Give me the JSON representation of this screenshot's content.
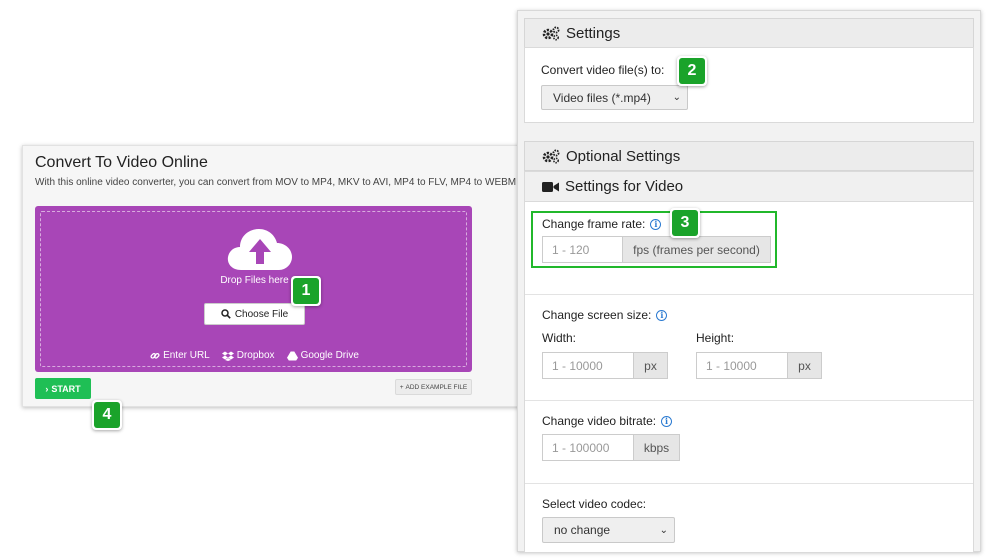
{
  "converter": {
    "title": "Convert To Video Online",
    "description": "With this online video converter, you can convert from MOV to MP4, MKV to AVI, MP4 to FLV, MP4 to WEBM",
    "drop_text": "Drop Files here",
    "choose_file_label": "Choose File",
    "sources": [
      {
        "label": "Enter URL",
        "icon": "link-icon"
      },
      {
        "label": "Dropbox",
        "icon": "dropbox-icon"
      },
      {
        "label": "Google Drive",
        "icon": "google-drive-icon"
      }
    ],
    "start_label": "START",
    "example_label": "ADD EXAMPLE FILE",
    "accent_color": "#a846b7",
    "start_color": "#1fbf55"
  },
  "settings": {
    "header": "Settings",
    "convert_label": "Convert video file(s) to:",
    "convert_value": "Video files (*.mp4)"
  },
  "optional": {
    "header": "Optional Settings",
    "video_header": "Settings for Video",
    "frame_rate": {
      "label": "Change frame rate:",
      "placeholder": "1 - 120",
      "unit": "fps (frames per second)"
    },
    "screen_size": {
      "label": "Change screen size:",
      "width_label": "Width:",
      "width_placeholder": "1 - 10000",
      "width_unit": "px",
      "height_label": "Height:",
      "height_placeholder": "1 - 10000",
      "height_unit": "px"
    },
    "bitrate": {
      "label": "Change video bitrate:",
      "placeholder": "1 - 100000",
      "unit": "kbps"
    },
    "codec": {
      "label": "Select video codec:",
      "value": "no change"
    }
  },
  "badges": [
    "1",
    "2",
    "3",
    "4"
  ],
  "badge_color": "#1aa32a"
}
